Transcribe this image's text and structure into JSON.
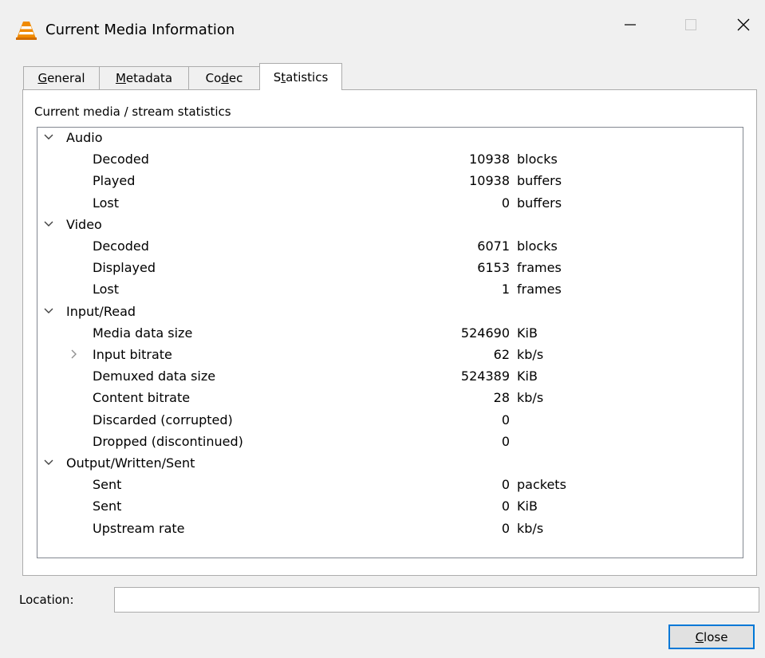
{
  "window": {
    "title": "Current Media Information",
    "controls": [
      "minimize-icon",
      "maximize-icon",
      "close-icon"
    ]
  },
  "tabs": [
    {
      "label": "General",
      "accel": "G",
      "active": false
    },
    {
      "label": "Metadata",
      "accel": "M",
      "active": false
    },
    {
      "label": "Codec",
      "accel": "d",
      "active": false
    },
    {
      "label": "Statistics",
      "accel": "t",
      "active": true
    }
  ],
  "panel": {
    "label": "Current media / stream statistics"
  },
  "tree": [
    {
      "type": "group",
      "name": "Audio",
      "expanded": true
    },
    {
      "type": "item",
      "name": "Decoded",
      "value": "10938",
      "unit": "blocks"
    },
    {
      "type": "item",
      "name": "Played",
      "value": "10938",
      "unit": "buffers"
    },
    {
      "type": "item",
      "name": "Lost",
      "value": "0",
      "unit": "buffers"
    },
    {
      "type": "group",
      "name": "Video",
      "expanded": true
    },
    {
      "type": "item",
      "name": "Decoded",
      "value": "6071",
      "unit": "blocks"
    },
    {
      "type": "item",
      "name": "Displayed",
      "value": "6153",
      "unit": "frames"
    },
    {
      "type": "item",
      "name": "Lost",
      "value": "1",
      "unit": "frames"
    },
    {
      "type": "group",
      "name": "Input/Read",
      "expanded": true
    },
    {
      "type": "item",
      "name": "Media data size",
      "value": "524690",
      "unit": "KiB"
    },
    {
      "type": "item",
      "name": "Input bitrate",
      "value": "62",
      "unit": "kb/s",
      "collapsed_child": true
    },
    {
      "type": "item",
      "name": "Demuxed data size",
      "value": "524389",
      "unit": "KiB"
    },
    {
      "type": "item",
      "name": "Content bitrate",
      "value": "28",
      "unit": "kb/s"
    },
    {
      "type": "item",
      "name": "Discarded (corrupted)",
      "value": "0",
      "unit": ""
    },
    {
      "type": "item",
      "name": "Dropped (discontinued)",
      "value": "0",
      "unit": ""
    },
    {
      "type": "group",
      "name": "Output/Written/Sent",
      "expanded": true
    },
    {
      "type": "item",
      "name": "Sent",
      "value": "0",
      "unit": "packets"
    },
    {
      "type": "item",
      "name": "Sent",
      "value": "0",
      "unit": "KiB"
    },
    {
      "type": "item",
      "name": "Upstream rate",
      "value": "0",
      "unit": "kb/s"
    }
  ],
  "location": {
    "label": "Location:",
    "value": ""
  },
  "close_button": {
    "label": "Close",
    "accel": "C"
  },
  "colors": {
    "window_bg": "#f0f0f0",
    "panel_bg": "#ffffff",
    "border": "#acacac",
    "focus_border": "#0078d7",
    "cone_orange": "#f08a00"
  }
}
